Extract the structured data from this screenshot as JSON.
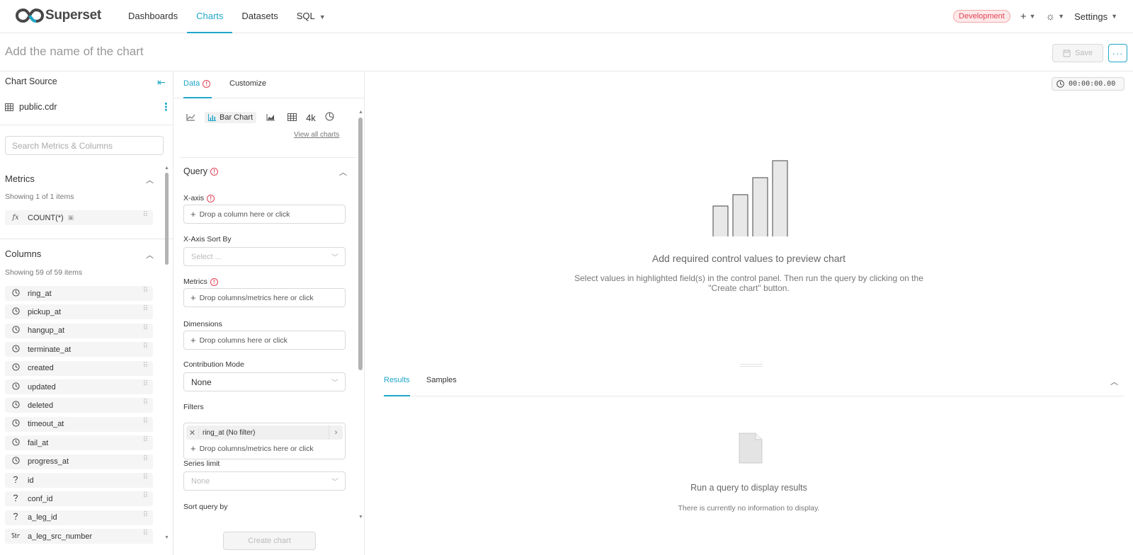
{
  "nav": {
    "brand": "Superset",
    "links": [
      "Dashboards",
      "Charts",
      "Datasets",
      "SQL"
    ],
    "environment": "Development",
    "settings_label": "Settings",
    "accent_color": "#20a7c9"
  },
  "header": {
    "chart_name_placeholder": "Add the name of the chart",
    "save_label": "Save",
    "more_label": "···"
  },
  "source": {
    "title": "Chart Source",
    "dataset": "public.cdr",
    "search_placeholder": "Search Metrics & Columns"
  },
  "metrics": {
    "heading": "Metrics",
    "count": "Showing 1 of 1 items",
    "items": [
      {
        "icon": "fx",
        "name": "COUNT(*)"
      }
    ]
  },
  "columns": {
    "heading": "Columns",
    "count": "Showing 59 of 59 items",
    "items": [
      {
        "type": "time",
        "name": "ring_at"
      },
      {
        "type": "time",
        "name": "pickup_at"
      },
      {
        "type": "time",
        "name": "hangup_at"
      },
      {
        "type": "time",
        "name": "terminate_at"
      },
      {
        "type": "time",
        "name": "created"
      },
      {
        "type": "time",
        "name": "updated"
      },
      {
        "type": "time",
        "name": "deleted"
      },
      {
        "type": "time",
        "name": "timeout_at"
      },
      {
        "type": "time",
        "name": "fail_at"
      },
      {
        "type": "time",
        "name": "progress_at"
      },
      {
        "type": "unknown",
        "name": "id"
      },
      {
        "type": "unknown",
        "name": "conf_id"
      },
      {
        "type": "unknown",
        "name": "a_leg_id"
      },
      {
        "type": "string",
        "name": "a_leg_src_number"
      }
    ]
  },
  "control": {
    "tab_data": "Data",
    "tab_customize": "Customize",
    "viz_active": "Bar Chart",
    "viz_big_number": "4k",
    "view_all": "View all charts",
    "query_heading": "Query",
    "x_axis_label": "X-axis",
    "x_axis_drop": "Drop a column here or click",
    "x_sort_label": "X-Axis Sort By",
    "x_sort_placeholder": "Select ...",
    "metrics_label": "Metrics",
    "metrics_drop": "Drop columns/metrics here or click",
    "dimensions_label": "Dimensions",
    "dimensions_drop": "Drop columns here or click",
    "contribution_label": "Contribution Mode",
    "contribution_value": "None",
    "filters_label": "Filters",
    "filter_pill": "ring_at (No filter)",
    "filters_drop": "Drop columns/metrics here or click",
    "series_limit_label": "Series limit",
    "series_limit_placeholder": "None",
    "sort_query_label": "Sort query by",
    "create_chart": "Create chart"
  },
  "preview": {
    "timer": "00:00:00.00",
    "empty_title": "Add required control values to preview chart",
    "empty_desc": "Select values in highlighted field(s) in the control panel. Then run the query by clicking on the \"Create chart\" button.",
    "tab_results": "Results",
    "tab_samples": "Samples",
    "results_title": "Run a query to display results",
    "results_desc": "There is currently no information to display."
  }
}
